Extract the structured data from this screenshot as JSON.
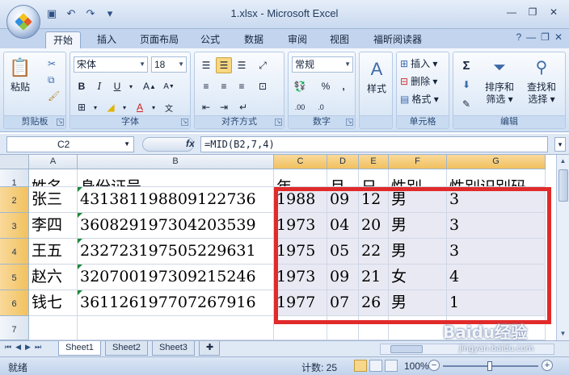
{
  "window": {
    "title": "1.xlsx - Microsoft Excel"
  },
  "tabs": [
    "开始",
    "插入",
    "页面布局",
    "公式",
    "数据",
    "审阅",
    "视图",
    "福昕阅读器"
  ],
  "ribbon": {
    "clipboard": {
      "paste": "粘贴",
      "label": "剪贴板"
    },
    "font": {
      "name": "宋体",
      "size": "18",
      "label": "字体"
    },
    "alignment": {
      "label": "对齐方式"
    },
    "number": {
      "format": "常规",
      "label": "数字"
    },
    "styles": {
      "button": "样式"
    },
    "cells": {
      "insert": "插入",
      "delete": "删除",
      "format": "格式",
      "label": "单元格"
    },
    "editing": {
      "sort": "排序和\n筛选",
      "sort1": "排序和",
      "sort2": "筛选",
      "find1": "查找和",
      "find2": "选择",
      "label": "编辑"
    }
  },
  "formula_bar": {
    "name_box": "C2",
    "fx": "fx",
    "formula": "=MID(B2,7,4)"
  },
  "columns": [
    "A",
    "B",
    "C",
    "D",
    "E",
    "F",
    "G"
  ],
  "rows": [
    {
      "n": "1",
      "cells": [
        "姓名",
        "身份证号",
        "年",
        "月",
        "日",
        "性别",
        "性别识别码"
      ]
    },
    {
      "n": "2",
      "cells": [
        "张三",
        "431381198809122736",
        "1988",
        "09",
        "12",
        "男",
        "3"
      ]
    },
    {
      "n": "3",
      "cells": [
        "李四",
        "360829197304203539",
        "1973",
        "04",
        "20",
        "男",
        "3"
      ]
    },
    {
      "n": "4",
      "cells": [
        "王五",
        "232723197505229631",
        "1975",
        "05",
        "22",
        "男",
        "3"
      ]
    },
    {
      "n": "5",
      "cells": [
        "赵六",
        "320700197309215246",
        "1973",
        "09",
        "21",
        "女",
        "4"
      ]
    },
    {
      "n": "6",
      "cells": [
        "钱七",
        "361126197707267916",
        "1977",
        "07",
        "26",
        "男",
        "1"
      ]
    },
    {
      "n": "7",
      "cells": [
        "",
        "",
        "",
        "",
        "",
        "",
        ""
      ]
    }
  ],
  "sheets": [
    "Sheet1",
    "Sheet2",
    "Sheet3"
  ],
  "status": {
    "ready": "就绪",
    "count": "计数: 25",
    "zoom": "100%"
  },
  "watermark": {
    "main": "Baidu经验",
    "sub": "jingyan.baidu.com"
  },
  "colors": {
    "selection_border": "#e12a2a",
    "header_selected": "#f1c15f",
    "ribbon_bg": "#dbe7f6"
  }
}
